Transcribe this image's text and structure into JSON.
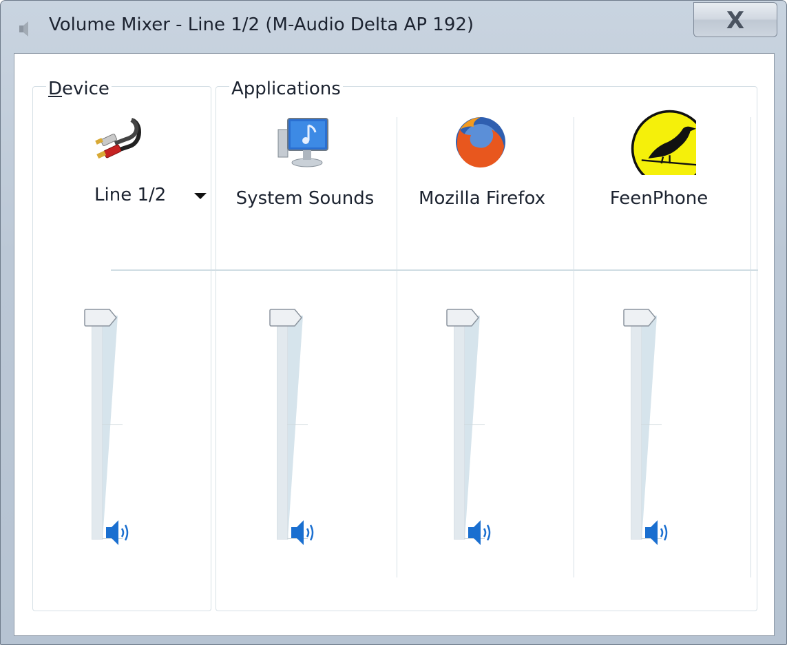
{
  "window": {
    "title": "Volume Mixer - Line 1/2 (M-Audio Delta AP 192)"
  },
  "titlebar_icon": "speaker-icon",
  "close_button": {
    "label": "X"
  },
  "device_group": {
    "legend_first": "D",
    "legend_rest": "evice",
    "device_icon": "rca-cable-icon",
    "selected_device": "Line 1/2",
    "volume_percent": 100,
    "mute_icon": "speaker-on-icon"
  },
  "applications_group": {
    "legend": "Applications",
    "apps": [
      {
        "name": "System Sounds",
        "icon": "monitor-music-icon",
        "volume_percent": 100,
        "mute_icon": "speaker-on-icon"
      },
      {
        "name": "Mozilla Firefox",
        "icon": "firefox-icon",
        "volume_percent": 100,
        "mute_icon": "speaker-on-icon"
      },
      {
        "name": "FeenPhone",
        "icon": "bird-icon",
        "volume_percent": 100,
        "mute_icon": "speaker-on-icon"
      }
    ]
  },
  "colors": {
    "accent": "#1a6fd0",
    "track": "#dde9f0",
    "border": "#d5dfe5"
  }
}
